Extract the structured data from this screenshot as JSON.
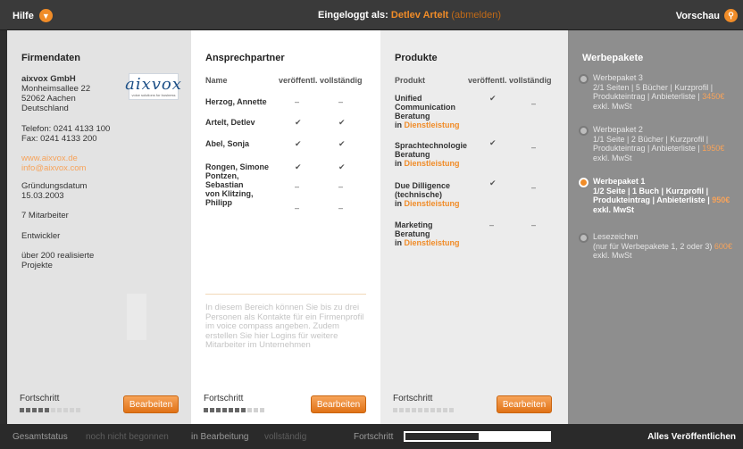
{
  "topbar": {
    "help": "Hilfe",
    "logged_in_label": "Eingeloggt als:",
    "user": "Detlev Artelt",
    "logout": "(abmelden)",
    "preview": "Vorschau"
  },
  "firmendaten": {
    "title": "Firmendaten",
    "company": "aixvox GmbH",
    "street": "Monheimsallee 22",
    "city": "52062 Aachen",
    "country": "Deutschland",
    "phone": "Telefon: 0241 4133 100",
    "fax": "Fax: 0241 4133 200",
    "website": "www.aixvox.de",
    "email": "info@aixvox.com",
    "founding_label": "Gründungsdatum",
    "founding_date": "15.03.2003",
    "employees": "7 Mitarbeiter",
    "type": "Entwickler",
    "projects_1": "über 200 realisierte",
    "projects_2": "Projekte",
    "logo_text": "aixvox",
    "logo_sub": "voice solutions for business",
    "progress_label": "Fortschritt",
    "progress_value": 0.5,
    "edit": "Bearbeiten"
  },
  "ansprechpartner": {
    "title": "Ansprechpartner",
    "col_name": "Name",
    "col_pub": "veröffentl.",
    "col_full": "vollständig",
    "rows": [
      {
        "line1": "Herzog, Annette",
        "line2": "",
        "line3": "",
        "pub": "–",
        "full": "–"
      },
      {
        "line1": "Artelt, Detlev",
        "line2": "",
        "line3": "",
        "pub": "✔",
        "full": "✔"
      },
      {
        "line1": "Abel, Sonja",
        "line2": "",
        "line3": "",
        "pub": "✔",
        "full": "✔"
      },
      {
        "line1": "Rongen, Simone",
        "line2": "",
        "line3": "",
        "pub": "✔",
        "full": "✔"
      },
      {
        "line1": "Pontzen,",
        "line2": "Sebastian",
        "line3": "",
        "pub": "–",
        "full": "–"
      },
      {
        "line1": "von Klitzing,",
        "line2": "Philipp",
        "line3": "",
        "pub": "–",
        "full": "–"
      }
    ],
    "info_text": "In diesem Bereich können Sie bis zu drei Personen als Kontakte für ein Firmenprofil im voice compass angeben. Zudem erstellen Sie hier Logins für weitere Mitarbeiter im Unternehmen",
    "progress_label": "Fortschritt",
    "progress_value": 0.7,
    "edit": "Bearbeiten"
  },
  "produkte": {
    "title": "Produkte",
    "col_name": "Produkt",
    "col_pub": "veröffentl.",
    "col_full": "vollständig",
    "in_label": "in",
    "rows": [
      {
        "line1": "Unified",
        "line2": "Communication",
        "line3": "Beratung",
        "category": "Dienstleistung",
        "pub": "✔",
        "full": "–"
      },
      {
        "line1": "Sprachtechnologie",
        "line2": "Beratung",
        "line3": "",
        "category": "Dienstleistung",
        "pub": "✔",
        "full": "–"
      },
      {
        "line1": "Due Dilligence",
        "line2": "(technische)",
        "line3": "",
        "category": "Dienstleistung",
        "pub": "✔",
        "full": "–"
      },
      {
        "line1": "Marketing",
        "line2": "Beratung",
        "line3": "",
        "category": "Dienstleistung",
        "pub": "–",
        "full": "–"
      }
    ],
    "progress_label": "Fortschritt",
    "progress_value": 0,
    "edit": "Bearbeiten"
  },
  "werbepakete": {
    "title": "Werbepakete",
    "items": [
      {
        "name": "Werbepaket 3",
        "desc": "2/1 Seiten | 5 Bücher | Kurzprofil | Produkteintrag | Anbieterliste |",
        "price": "3450€",
        "tax": "exkl. MwSt",
        "selected": false
      },
      {
        "name": "Werbepaket 2",
        "desc": "1/1 Seite | 2 Bücher | Kurzprofil | Produkteintrag | Anbieterliste |",
        "price": "1950€",
        "tax": "exkl. MwSt",
        "selected": false
      },
      {
        "name": "Werbepaket 1",
        "desc": "1/2 Seite | 1 Buch | Kurzprofil | Produkteintrag | Anbieterliste |",
        "price": "950€",
        "tax": "exkl. MwSt",
        "selected": true
      },
      {
        "name": "Lesezeichen",
        "desc": "(nur für Werbepakete 1, 2 oder 3)",
        "price": "600€",
        "tax": "exkl. MwSt",
        "selected": false
      }
    ]
  },
  "bottombar": {
    "overall": "Gesamtstatus",
    "not_started": "noch nicht begonnen",
    "in_progress": "in Bearbeitung",
    "complete": "vollständig",
    "progress_label": "Fortschritt",
    "progress_value": 0.5,
    "publish_all": "Alles Veröffentlichen"
  },
  "colors": {
    "accent": "#f08c28",
    "topbar": "#3a3a3a",
    "bottombar": "#2a2a2a",
    "werbepakete_bg": "#8e8e8e"
  }
}
